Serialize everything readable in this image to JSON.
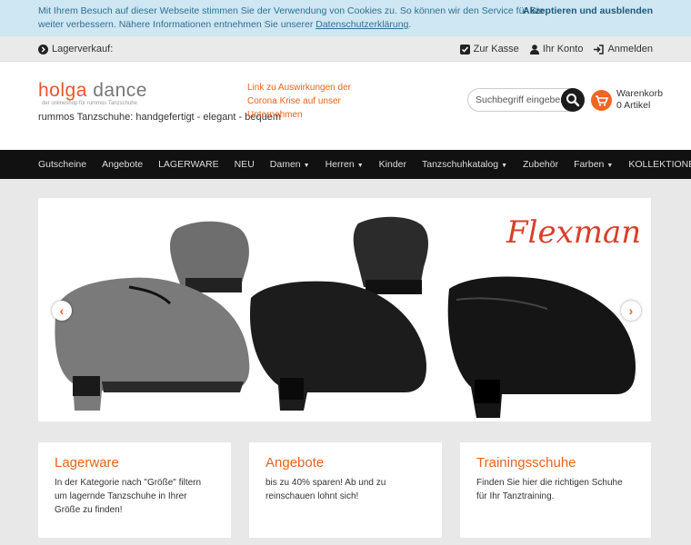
{
  "cookie": {
    "message": "Mit Ihrem Besuch auf dieser Webseite stimmen Sie der Verwendung von Cookies zu. So können wir den Service für Sie weiter verbessern. Nähere Informationen entnehmen Sie unserer ",
    "link": "Datenschutzerklärung",
    "suffix": ".",
    "accept": "Akzeptieren und ausblenden"
  },
  "topbar": {
    "lagerverkauf": "Lagerverkauf:",
    "kasse": "Zur Kasse",
    "konto": "Ihr Konto",
    "anmelden": "Anmelden"
  },
  "header": {
    "logo_part1": "holga",
    "logo_part2": " dance",
    "logo_tag": "der onlineshop für rummos Tanzschuhe",
    "slogan": "rummos Tanzschuhe: handgefertigt - elegant - bequem",
    "corona_link": "Link zu Auswirkungen der Corona Krise auf unser Unternehmen",
    "search_placeholder": "Suchbegriff eingeben",
    "cart_label": "Warenkorb",
    "cart_count": "0 Artikel"
  },
  "nav": [
    {
      "label": "Gutscheine",
      "dropdown": false
    },
    {
      "label": "Angebote",
      "dropdown": false
    },
    {
      "label": "LAGERWARE",
      "dropdown": false
    },
    {
      "label": "NEU",
      "dropdown": false
    },
    {
      "label": "Damen",
      "dropdown": true
    },
    {
      "label": "Herren",
      "dropdown": true
    },
    {
      "label": "Kinder",
      "dropdown": false
    },
    {
      "label": "Tanzschuhkatalog",
      "dropdown": true
    },
    {
      "label": "Zubehör",
      "dropdown": false
    },
    {
      "label": "Farben",
      "dropdown": true
    },
    {
      "label": "KOLLEKTIONEN",
      "dropdown": true
    }
  ],
  "slider": {
    "brand_text": "Flexman"
  },
  "cards": [
    {
      "title": "Lagerware",
      "text": "In der Kategorie nach \"Größe\" filtern um lagernde Tanzschuhe in Ihrer Größe zu finden!"
    },
    {
      "title": "Angebote",
      "text": "bis zu 40% sparen! Ab und zu reinschauen lohnt sich!"
    },
    {
      "title": "Trainingsschuhe",
      "text": "Finden Sie hier die richtigen Schuhe für Ihr Tanztraining."
    }
  ],
  "colors": {
    "accent": "#f26522",
    "nav_bg": "#111111",
    "cookie_bg": "#cfe6f3"
  }
}
